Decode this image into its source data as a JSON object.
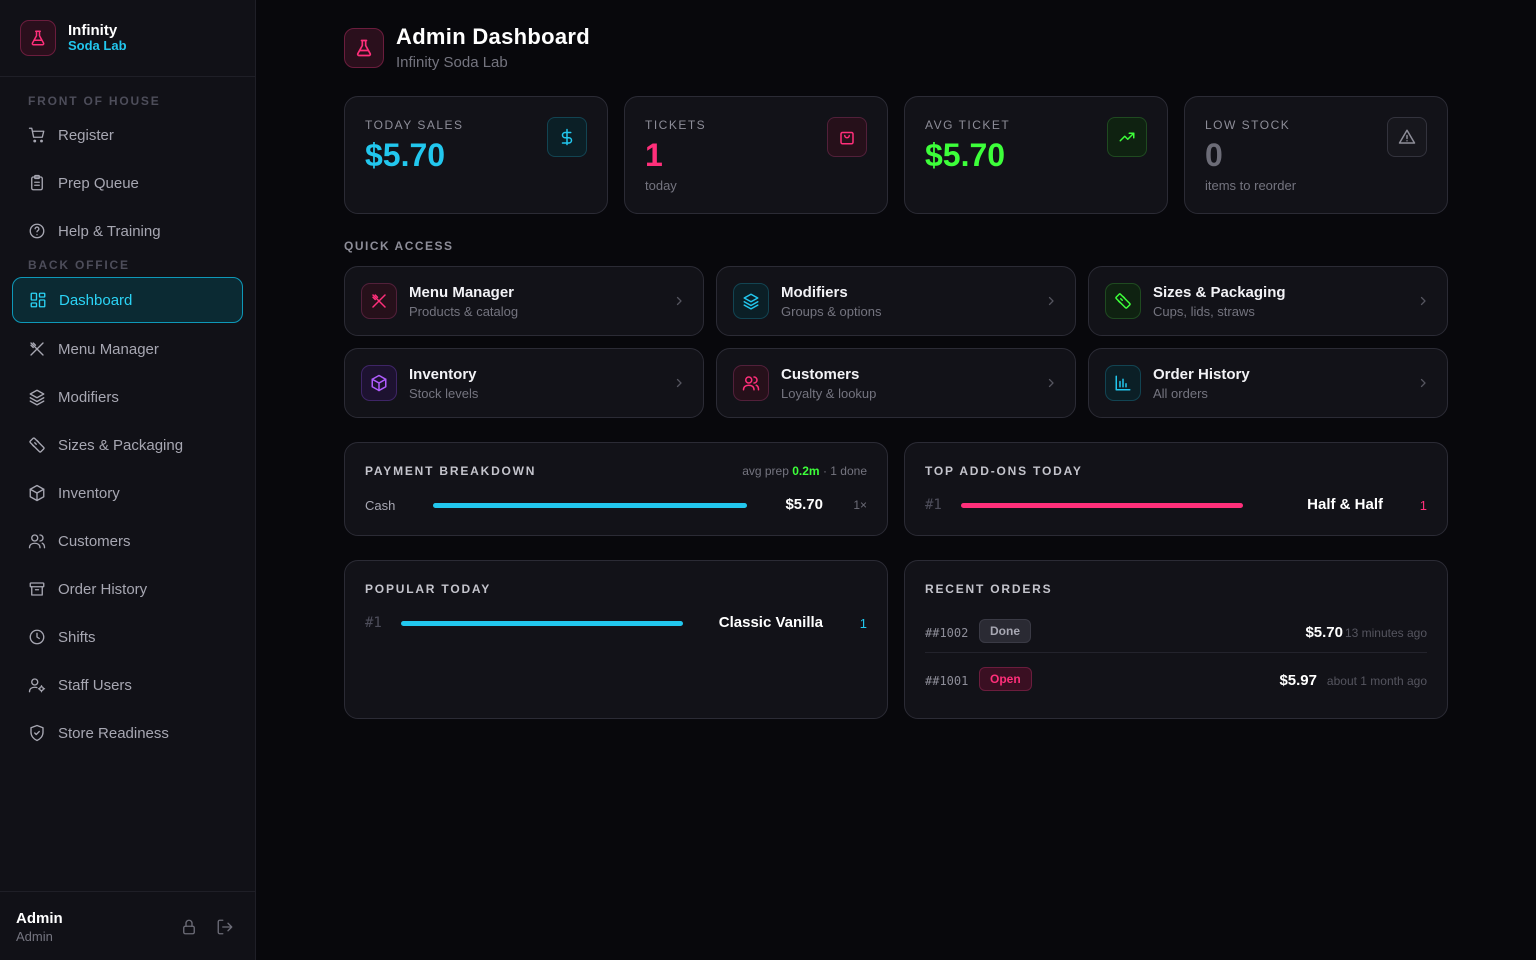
{
  "brand": {
    "line1": "Infinity",
    "line2": "Soda Lab"
  },
  "sidebar": {
    "front_label": "FRONT OF HOUSE",
    "back_label": "BACK OFFICE",
    "front_items": [
      {
        "label": "Register",
        "icon": "cart-icon"
      },
      {
        "label": "Prep Queue",
        "icon": "clipboard-icon"
      },
      {
        "label": "Help & Training",
        "icon": "help-circle-icon"
      }
    ],
    "back_items": [
      {
        "label": "Dashboard",
        "icon": "grid-icon",
        "active": true
      },
      {
        "label": "Menu Manager",
        "icon": "utensils-icon"
      },
      {
        "label": "Modifiers",
        "icon": "layers-icon"
      },
      {
        "label": "Sizes & Packaging",
        "icon": "ruler-icon"
      },
      {
        "label": "Inventory",
        "icon": "box-icon"
      },
      {
        "label": "Customers",
        "icon": "users-icon"
      },
      {
        "label": "Order History",
        "icon": "archive-icon"
      },
      {
        "label": "Shifts",
        "icon": "clock-icon"
      },
      {
        "label": "Staff Users",
        "icon": "user-cog-icon"
      },
      {
        "label": "Store Readiness",
        "icon": "shield-check-icon"
      }
    ],
    "footer": {
      "name": "Admin",
      "role": "Admin"
    }
  },
  "header": {
    "title": "Admin Dashboard",
    "subtitle": "Infinity Soda Lab"
  },
  "stats": [
    {
      "label": "TODAY SALES",
      "value": "$5.70",
      "sub": "",
      "color": "#22c7ee",
      "icon": "dollar-icon"
    },
    {
      "label": "TICKETS",
      "value": "1",
      "sub": "today",
      "color": "#ff2f7a",
      "icon": "bag-icon"
    },
    {
      "label": "AVG TICKET",
      "value": "$5.70",
      "sub": "",
      "color": "#3dff3a",
      "icon": "trend-up-icon"
    },
    {
      "label": "LOW STOCK",
      "value": "0",
      "sub": "items to reorder",
      "color": "#6c6c77",
      "icon": "warning-icon"
    }
  ],
  "quick_access": {
    "label": "QUICK ACCESS",
    "items": [
      {
        "title": "Menu Manager",
        "sub": "Products & catalog",
        "icon": "utensils-icon",
        "color": "#ff2f7a"
      },
      {
        "title": "Modifiers",
        "sub": "Groups & options",
        "icon": "layers-icon",
        "color": "#22c7ee"
      },
      {
        "title": "Sizes & Packaging",
        "sub": "Cups, lids, straws",
        "icon": "ruler-icon",
        "color": "#3dff3a"
      },
      {
        "title": "Inventory",
        "sub": "Stock levels",
        "icon": "box-icon",
        "color": "#b05cff"
      },
      {
        "title": "Customers",
        "sub": "Loyalty & lookup",
        "icon": "users-icon",
        "color": "#ff2f7a"
      },
      {
        "title": "Order History",
        "sub": "All orders",
        "icon": "chart-icon",
        "color": "#22c7ee"
      }
    ]
  },
  "payment": {
    "title": "PAYMENT BREAKDOWN",
    "avg_prefix": "avg prep",
    "avg_value": "0.2m",
    "avg_suffix": "· 1 done",
    "rows": [
      {
        "method": "Cash",
        "amount": "$5.70",
        "count": "1×",
        "fraction": 1.0
      }
    ]
  },
  "addons": {
    "title": "TOP ADD-ONS TODAY",
    "rows": [
      {
        "rank": "#1",
        "name": "Half & Half",
        "count": "1",
        "fraction": 1.0
      }
    ]
  },
  "popular": {
    "title": "POPULAR TODAY",
    "rows": [
      {
        "rank": "#1",
        "name": "Classic Vanilla",
        "count": "1",
        "fraction": 1.0
      }
    ]
  },
  "recent": {
    "title": "RECENT ORDERS",
    "orders": [
      {
        "id": "##1002",
        "status": "Done",
        "amount": "$5.70",
        "time": "13 minutes ago"
      },
      {
        "id": "##1001",
        "status": "Open",
        "amount": "$5.97",
        "time": "about 1 month ago"
      }
    ]
  }
}
